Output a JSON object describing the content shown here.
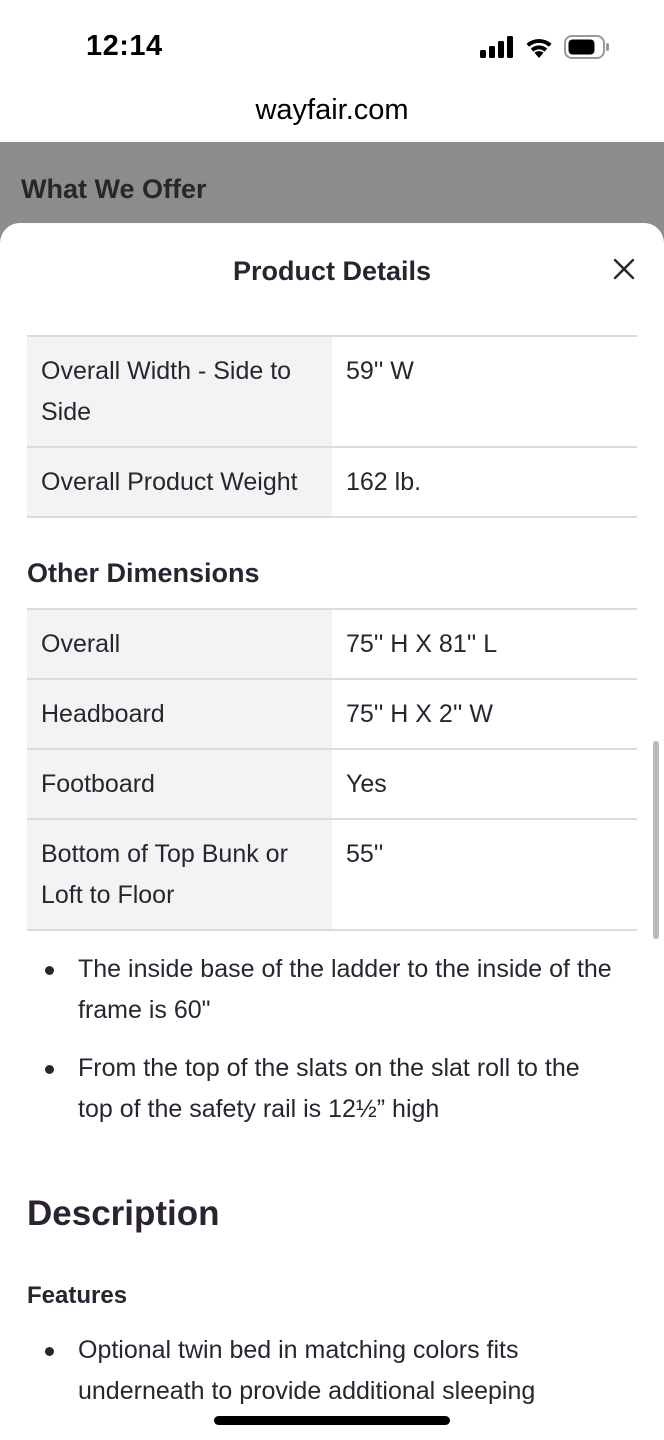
{
  "status_bar": {
    "time": "12:14"
  },
  "browser": {
    "url": "wayfair.com"
  },
  "background_page": {
    "section_title": "What We Offer"
  },
  "sheet": {
    "title": "Product Details",
    "close_icon": "close-icon"
  },
  "dimensions_table": {
    "rows": [
      {
        "label": "Overall Width - Side to Side",
        "value": "59'' W"
      },
      {
        "label": "Overall Product Weight",
        "value": "162 lb."
      }
    ]
  },
  "other_dimensions": {
    "heading": "Other Dimensions",
    "rows": [
      {
        "label": "Overall",
        "value": "75'' H X 81'' L"
      },
      {
        "label": "Headboard",
        "value": "75'' H X 2'' W"
      },
      {
        "label": "Footboard",
        "value": "Yes"
      },
      {
        "label": "Bottom of Top Bunk or Loft to Floor",
        "value": "55''"
      }
    ]
  },
  "notes": [
    "The inside base of the ladder to the inside of the frame is 60\"",
    "From the top of the slats on the slat roll to the top of the safety rail is 12½” high"
  ],
  "description": {
    "heading": "Description",
    "features_heading": "Features",
    "features": [
      "Optional twin bed in matching colors fits underneath to provide additional sleeping"
    ]
  },
  "colors": {
    "text": "#2b2430",
    "row_label_bg": "#f3f3f4",
    "divider": "#dcdadd",
    "overlay": "#8c8b8d"
  }
}
